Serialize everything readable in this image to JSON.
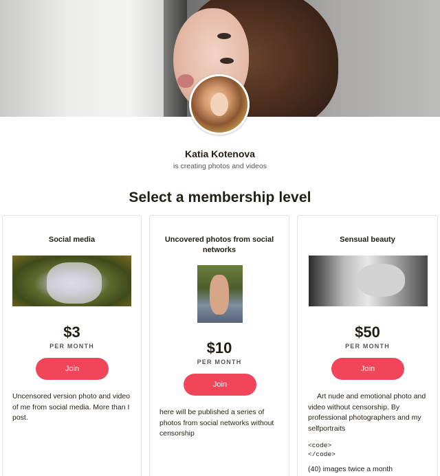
{
  "creator": {
    "name": "Katia Kotenova",
    "subtitle": "is creating photos and videos"
  },
  "section_title": "Select a membership level",
  "tiers": [
    {
      "title": "Social media",
      "price": "$3",
      "period": "PER MONTH",
      "join_label": "Join",
      "description": "Uncensored version photo and video of me from social media.  More than I post."
    },
    {
      "title": "Uncovered photos from social networks",
      "price": "$10",
      "period": "PER MONTH",
      "join_label": "Join",
      "description": "here will be published a series of photos from social networks without censorship"
    },
    {
      "title": "Sensual beauty",
      "price": "$50",
      "period": "PER MONTH",
      "join_label": "Join",
      "description": "Art nude and emotional photo and video without censorship. By professional photographers and my selfportraits",
      "code_open": "<code>",
      "code_close": "</code>",
      "extra": "(40) images twice a month"
    }
  ],
  "colors": {
    "accent": "#f1465a",
    "text": "#241e12",
    "muted": "#555555",
    "card_border": "#e5e3dd"
  }
}
